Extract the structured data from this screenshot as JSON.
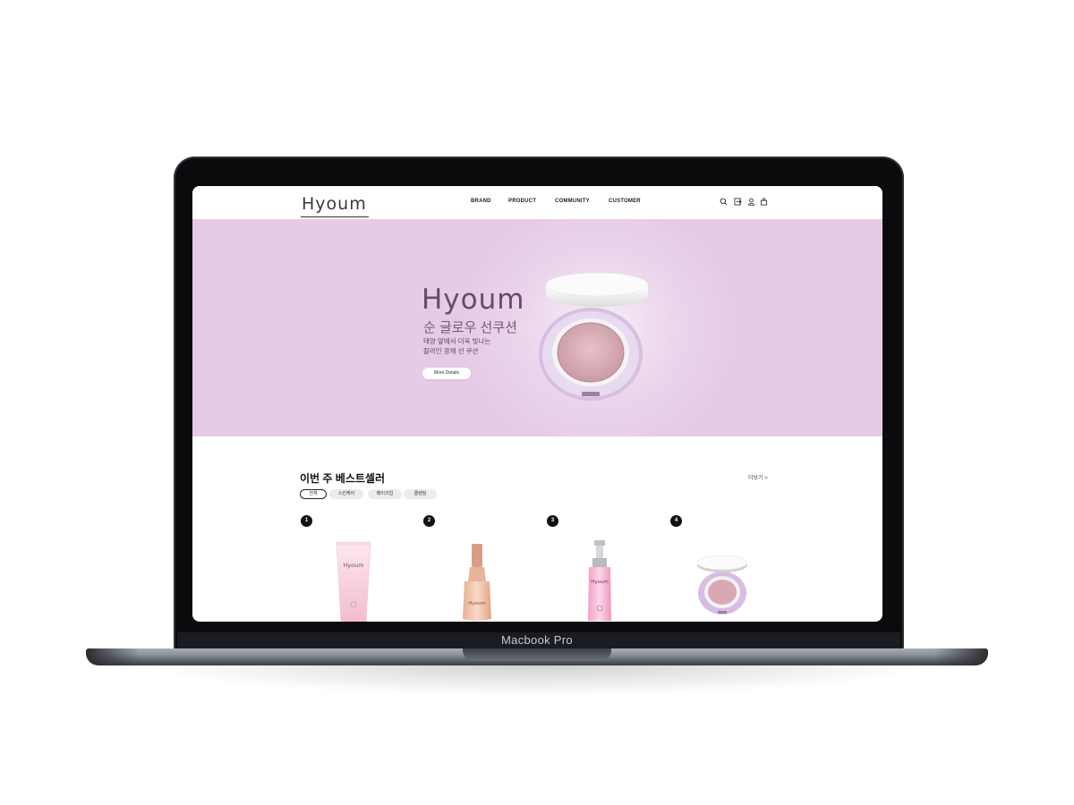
{
  "device": {
    "model_label": "Macbook Pro"
  },
  "header": {
    "logo": "Hyoum",
    "nav": [
      {
        "label": "BRAND"
      },
      {
        "label": "PRODUCT"
      },
      {
        "label": "COMMUNITY"
      },
      {
        "label": "CUSTOMER"
      }
    ],
    "icons": [
      "search-icon",
      "login-icon",
      "user-icon",
      "cart-icon"
    ]
  },
  "hero": {
    "brand": "Hyoum",
    "title": "순 글로우 선쿠션",
    "description": "태양 앞에서 더욱 빛나는\n촬라인 광채 선 쿠션",
    "button_label": "More Details",
    "background_color": "#e8cfe8"
  },
  "bestseller": {
    "title": "이번 주 베스트셀러",
    "more_label": "더보기 >",
    "filters": [
      {
        "label": "전체",
        "active": true
      },
      {
        "label": "스킨케어",
        "active": false
      },
      {
        "label": "메이크업",
        "active": false
      },
      {
        "label": "클렌징",
        "active": false
      }
    ],
    "products": [
      {
        "rank": "1",
        "brand_mark": "Hyoum"
      },
      {
        "rank": "2",
        "brand_mark": "Hyoum"
      },
      {
        "rank": "3",
        "brand_mark": "Hyoum"
      },
      {
        "rank": "4",
        "brand_mark": ""
      }
    ]
  }
}
